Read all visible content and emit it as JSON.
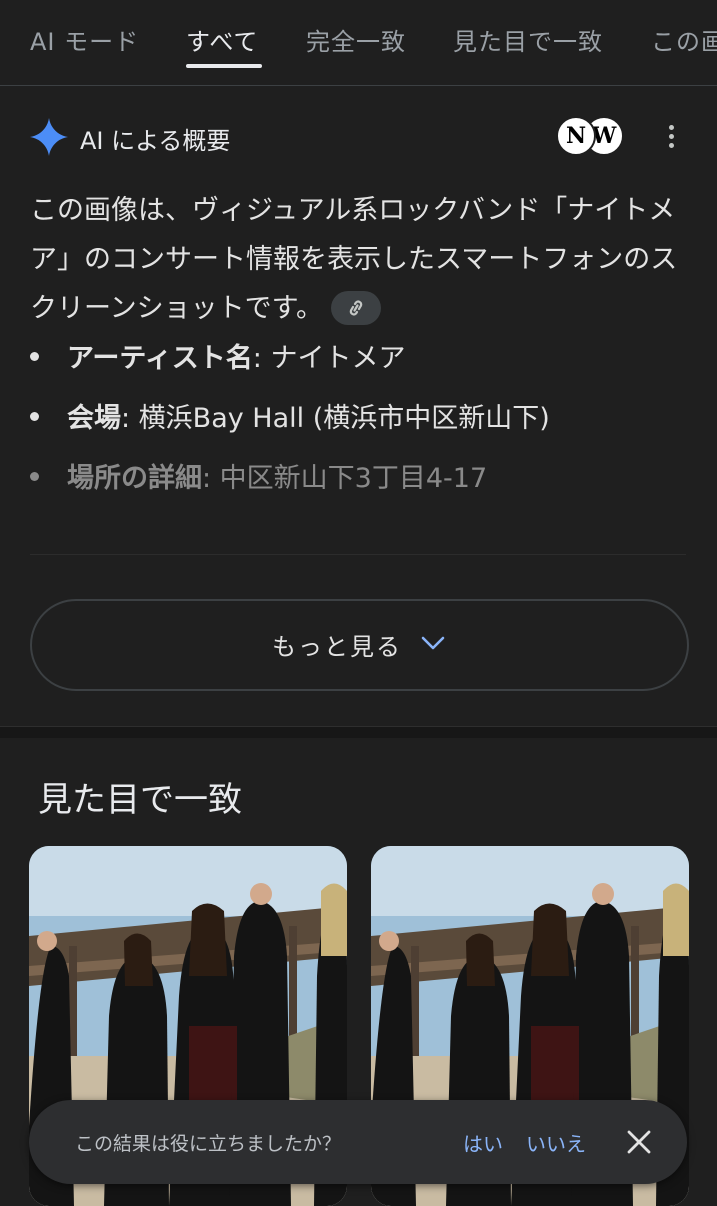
{
  "tabs": [
    {
      "label": "AI モード",
      "active": false
    },
    {
      "label": "すべて",
      "active": true
    },
    {
      "label": "完全一致",
      "active": false
    },
    {
      "label": "見た目で一致",
      "active": false
    },
    {
      "label": "この画",
      "active": false
    }
  ],
  "overview": {
    "title": "AI による概要",
    "sources": [
      "N",
      "W"
    ],
    "summary": "この画像は、ヴィジュアル系ロックバンド「ナイトメア」のコンサート情報を表示したスマートフォンのスクリーンショットです。",
    "bullets": [
      {
        "label": "アーティスト名",
        "value": ": ナイトメア"
      },
      {
        "label": "会場",
        "value": ": 横浜Bay Hall (横浜市中区新山下)"
      },
      {
        "label": "場所の詳細",
        "value": ": 中区新山下3丁目4-17"
      }
    ],
    "more_label": "もっと見る"
  },
  "visual_matches": {
    "title": "見た目で一致"
  },
  "feedback": {
    "question": "この結果は役に立ちましたか？",
    "yes": "はい",
    "no": "いいえ"
  },
  "colors": {
    "background": "#1f1f1f",
    "accent": "#8ab4f8",
    "sparkle": "#4c8df6"
  },
  "icons": [
    "sparkle-icon",
    "link-icon",
    "more-vert-icon",
    "chevron-down-icon",
    "close-icon"
  ]
}
